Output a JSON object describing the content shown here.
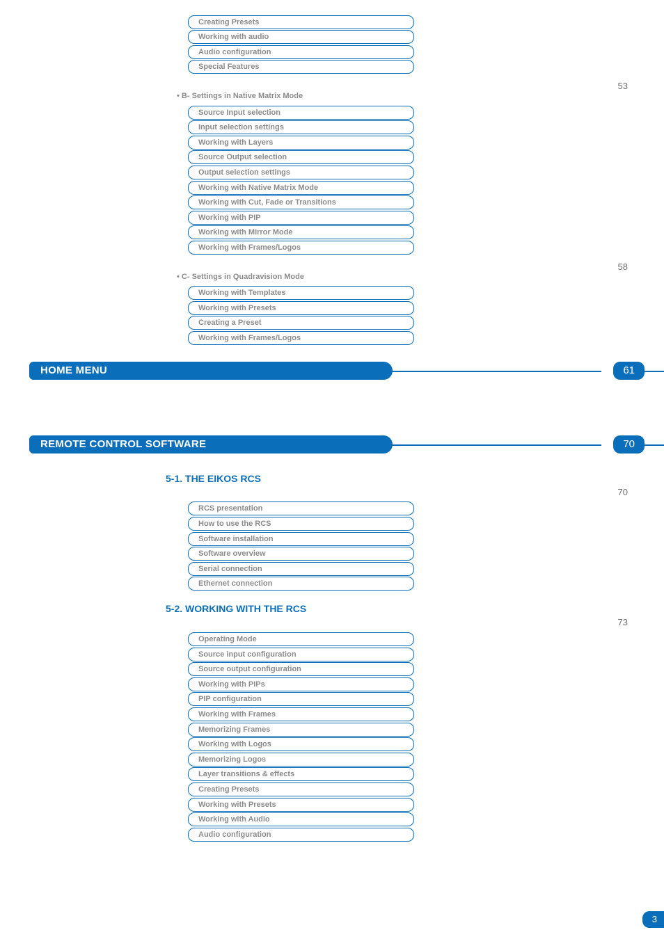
{
  "top_pills": [
    "Creating Presets",
    "Working with audio",
    "Audio configuration",
    "Special Features"
  ],
  "section_b": {
    "title": "B- Settings in Native Matrix Mode",
    "page": "53",
    "items": [
      "Source Input selection",
      "Input selection settings",
      "Working with Layers",
      "Source Output selection",
      "Output selection settings",
      "Working with Native Matrix Mode",
      "Working with Cut, Fade or Transitions",
      "Working with PIP",
      "Working with Mirror Mode",
      "Working with Frames/Logos"
    ]
  },
  "section_c": {
    "title": "C- Settings in Quadravision Mode",
    "page": "58",
    "items": [
      "Working with Templates",
      "Working with Presets",
      "Creating a Preset",
      "Working with Frames/Logos"
    ]
  },
  "home_menu": {
    "title": "HOME MENU",
    "page": "61"
  },
  "remote": {
    "title": "REMOTE CONTROL SOFTWARE",
    "page": "70"
  },
  "sec51": {
    "title": "5-1. THE EIKOS RCS",
    "page": "70",
    "items": [
      "RCS presentation",
      "How to use the RCS",
      "Software installation",
      "Software overview",
      "Serial connection",
      "Ethernet connection"
    ]
  },
  "sec52": {
    "title": "5-2. WORKING WITH THE RCS",
    "page": "73",
    "items": [
      "Operating Mode",
      "Source input configuration",
      "Source output configuration",
      "Working with PIPs",
      "PIP configuration",
      "Working with Frames",
      "Memorizing Frames",
      "Working with Logos",
      "Memorizing Logos",
      "Layer transitions & effects",
      "Creating Presets",
      "Working with Presets",
      "Working with Audio",
      "Audio configuration"
    ]
  },
  "footer_page": "3"
}
